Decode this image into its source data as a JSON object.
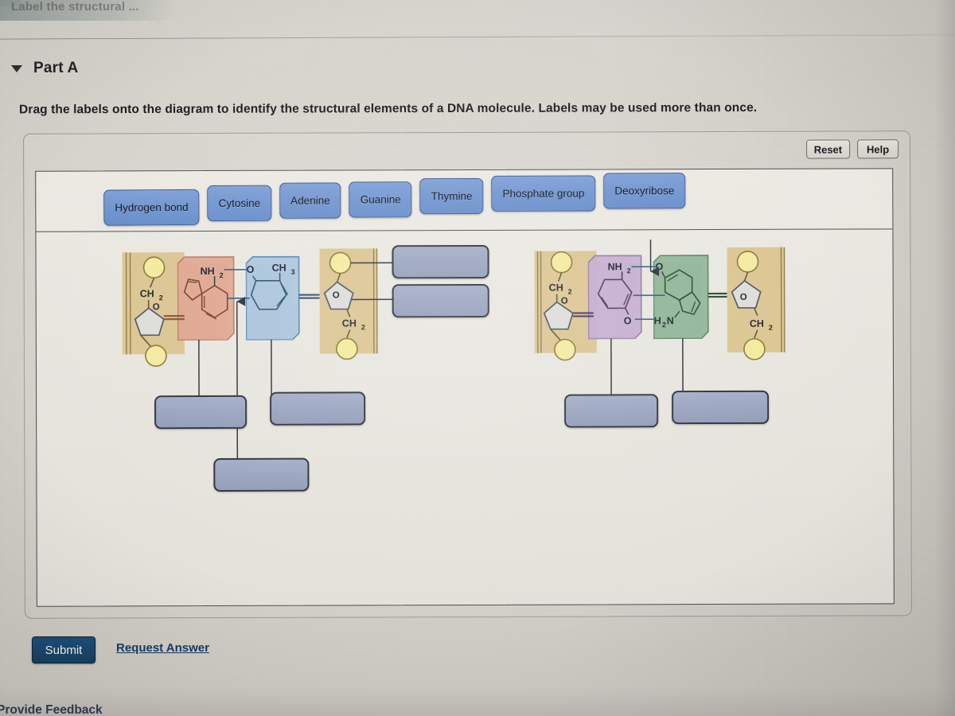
{
  "window": {
    "cutoff_header": "Label the structural ..."
  },
  "part": {
    "caret_icon": "triangle-down-icon",
    "title": "Part A",
    "prompt": "Drag the labels onto the diagram to identify the structural elements of a DNA molecule. Labels may be used more than once."
  },
  "tools": {
    "reset_label": "Reset",
    "help_label": "Help"
  },
  "label_bank": {
    "items": [
      {
        "label": "Hydrogen bond"
      },
      {
        "label": "Cytosine"
      },
      {
        "label": "Adenine"
      },
      {
        "label": "Guanine"
      },
      {
        "label": "Thymine"
      },
      {
        "label": "Phosphate group"
      },
      {
        "label": "Deoxyribose"
      }
    ]
  },
  "diagram": {
    "alt": "DNA base-pair structure diagram with two nucleotide pairs",
    "drop_slots": [
      {
        "id": "slot-top-center",
        "value": ""
      },
      {
        "id": "slot-right-upper",
        "value": ""
      },
      {
        "id": "slot-right-lower",
        "value": ""
      },
      {
        "id": "slot-bottom-left-1",
        "value": ""
      },
      {
        "id": "slot-bottom-left-2",
        "value": ""
      },
      {
        "id": "slot-bottom-left-3",
        "value": ""
      },
      {
        "id": "slot-bottom-right-1",
        "value": ""
      },
      {
        "id": "slot-bottom-right-2",
        "value": ""
      }
    ],
    "chemical_labels": {
      "ch2": "CH₂",
      "o": "O",
      "nh2": "NH₂",
      "ch3": "CH₃",
      "h2n": "H₂N"
    },
    "colors": {
      "adenine": "#d99b86",
      "thymine": "#a8c2dc",
      "cytosine": "#c3abcf",
      "guanine": "#8cb294",
      "backbone": "#ddc48a",
      "phosphate": "#f2e79a",
      "sugar": "#d8d8d6",
      "chip_blue": "#6f94d0",
      "slot_fill": "#97a2be"
    }
  },
  "footer": {
    "submit_label": "Submit",
    "request_answer_label": "Request Answer",
    "provide_feedback_label": "Provide Feedback"
  }
}
